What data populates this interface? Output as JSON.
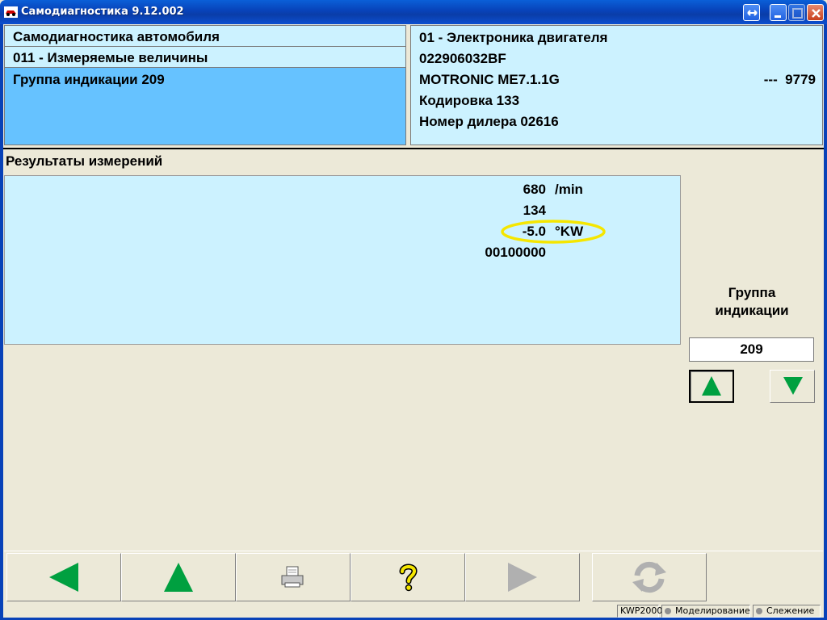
{
  "window": {
    "title": "Самодиагностика 9.12.002"
  },
  "header_left": {
    "mode": "Самодиагностика автомобиля",
    "function": "011 - Измеряемые величины",
    "group": "Группа индикации 209"
  },
  "header_right": {
    "module": "01 - Электроника двигателя",
    "part_number": "022906032BF",
    "component": "MOTRONIC ME7.1.1G",
    "component_aux": "---  9779",
    "coding": "Кодировка 133",
    "dealer": "Номер дилера 02616"
  },
  "results": {
    "label": "Результаты измерений",
    "rows": [
      {
        "value": "680",
        "unit": "/min"
      },
      {
        "value": "134",
        "unit": ""
      },
      {
        "value": "-5.0",
        "unit": "°KW",
        "highlighted": true
      },
      {
        "value": "00100000",
        "unit": ""
      }
    ],
    "highlight_color": "#f5e600"
  },
  "group_control": {
    "label": "Группа индикации",
    "value": "209",
    "up_icon": "arrow-up-icon",
    "down_icon": "arrow-down-icon"
  },
  "toolbar": {
    "buttons": [
      {
        "icon": "arrow-left-icon",
        "enabled": true
      },
      {
        "icon": "arrow-up-icon",
        "enabled": true
      },
      {
        "icon": "printer-icon",
        "enabled": true
      },
      {
        "icon": "help-icon",
        "enabled": true
      },
      {
        "icon": "arrow-right-icon",
        "enabled": false
      },
      {
        "icon": "refresh-icon",
        "enabled": false
      }
    ]
  },
  "statusbar": {
    "protocol": "KWP2000",
    "simulation": "Моделирование",
    "tracking": "Слежение"
  },
  "colors": {
    "titlebar": "#0842b8",
    "panel_light": "#ccf2ff",
    "panel_selected": "#66c2ff",
    "background": "#ece9d8",
    "arrow_green": "#00a040",
    "disabled": "#b0b0b0"
  }
}
